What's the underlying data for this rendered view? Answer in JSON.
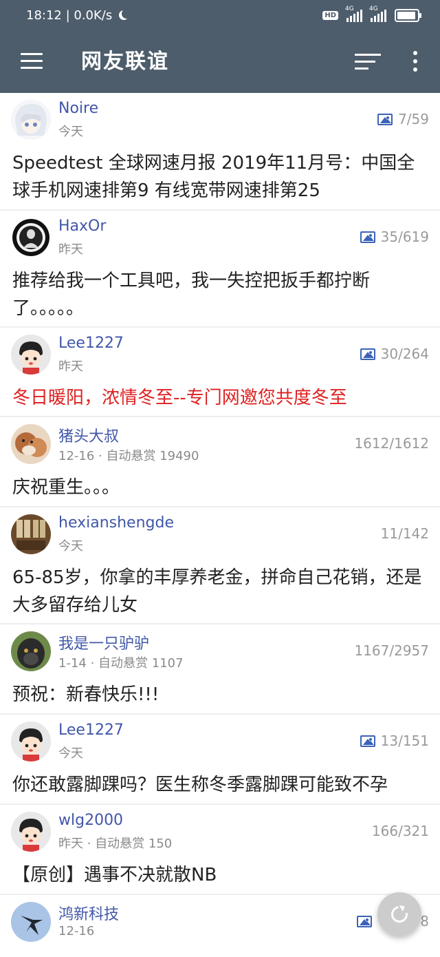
{
  "status_bar": {
    "time_speed": "18:12 | 0.0K/s",
    "hd": "HD",
    "net1": "4G",
    "net2": "4G"
  },
  "app_bar": {
    "title": "网友联谊"
  },
  "posts": [
    {
      "author": "Noire",
      "meta": "今天",
      "stats": "7/59",
      "has_image": true,
      "title": "Speedtest 全球网速月报 2019年11月号：中国全球手机网速排第9 有线宽带网速排第25"
    },
    {
      "author": "HaxOr",
      "meta": "昨天",
      "stats": "35/619",
      "has_image": true,
      "title": "推荐给我一个工具吧，我一失控把扳手都拧断了。。。。。"
    },
    {
      "author": "Lee1227",
      "meta": "昨天",
      "stats": "30/264",
      "has_image": true,
      "title": "冬日暖阳，浓情冬至--专门网邀您共度冬至",
      "title_color": "#e02020"
    },
    {
      "author": "猪头大叔",
      "meta": "12-16 · 自动悬赏 19490",
      "stats": "1612/1612",
      "has_image": false,
      "title": "庆祝重生。。。"
    },
    {
      "author": "hexianshengde",
      "meta": "今天",
      "stats": "11/142",
      "has_image": false,
      "title": "65-85岁，你拿的丰厚养老金，拼命自己花销，还是大多留存给儿女"
    },
    {
      "author": "我是一只驴驴",
      "meta": "1-14 · 自动悬赏 1107",
      "stats": "1167/2957",
      "has_image": false,
      "title": "预祝：新春快乐!!!"
    },
    {
      "author": "Lee1227",
      "meta": "今天",
      "stats": "13/151",
      "has_image": true,
      "title": "你还敢露脚踝吗？医生称冬季露脚踝可能致不孕"
    },
    {
      "author": "wlg2000",
      "meta": "昨天 · 自动悬赏 150",
      "stats": "166/321",
      "has_image": false,
      "title": "【原创】遇事不决就散NB"
    },
    {
      "author": "鸿新科技",
      "meta": "12-16",
      "stats": "8",
      "has_image": true,
      "title": ""
    }
  ]
}
